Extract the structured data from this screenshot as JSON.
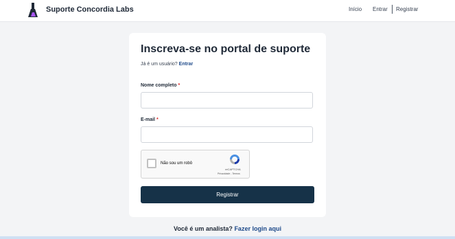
{
  "header": {
    "brand": "Suporte Concordia Labs",
    "nav": {
      "home": "Início",
      "login": "Entrar",
      "register": "Registrar"
    }
  },
  "form": {
    "title": "Inscreva-se no portal de suporte",
    "already_user": "Já é um usuário?",
    "login_link": "Entrar",
    "name_label": "Nome completo",
    "name_value": "",
    "email_label": "E-mail",
    "email_value": "",
    "required_mark": "*",
    "recaptcha": {
      "label": "Não sou um robô",
      "brand": "reCAPTCHA",
      "links": "Privacidade - Termos"
    },
    "submit_label": "Registrar"
  },
  "footer": {
    "question": "Você é um analista?",
    "link": "Fazer login aqui"
  },
  "colors": {
    "accent": "#163248",
    "link": "#1e4a8a",
    "required": "#dc2626",
    "background": "#f3f4f6"
  },
  "icons": {
    "logo": "flask-logo-icon",
    "captcha": "recaptcha-icon",
    "checkbox": "checkbox-icon"
  }
}
